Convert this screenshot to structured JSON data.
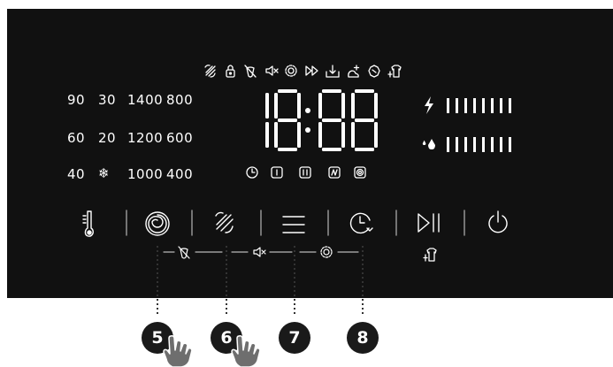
{
  "display": {
    "time": "18:88"
  },
  "temperatures": [
    "90",
    "30",
    "60",
    "20",
    "40"
  ],
  "spins": [
    "1400",
    "800",
    "1200",
    "600",
    "1000",
    "400"
  ],
  "cold_symbol": "❄",
  "status_icons": [
    "speed-wash-icon",
    "door-lock-icon",
    "stain-off-icon",
    "mute-icon",
    "settings-icon",
    "fast-forward-icon",
    "rinse-hold-icon",
    "steam-icon",
    "anti-crease-icon",
    "dry-icon"
  ],
  "phase_icons": [
    "time-delay-icon",
    "wash-phase-icon",
    "rinse-phase-icon",
    "spin-phase-icon",
    "drum-clean-icon"
  ],
  "energy_level": 8,
  "water_level": 8,
  "buttons": [
    "temperature-button",
    "program-button",
    "speed-button",
    "options-button",
    "delay-button",
    "start-pause-button",
    "power-button"
  ],
  "callouts": {
    "n5": "5",
    "n6": "6",
    "n7": "7",
    "n8": "8"
  },
  "colors": {
    "panel": "#111111",
    "foreground": "#ffffff",
    "callout": "#1a1a1a"
  }
}
